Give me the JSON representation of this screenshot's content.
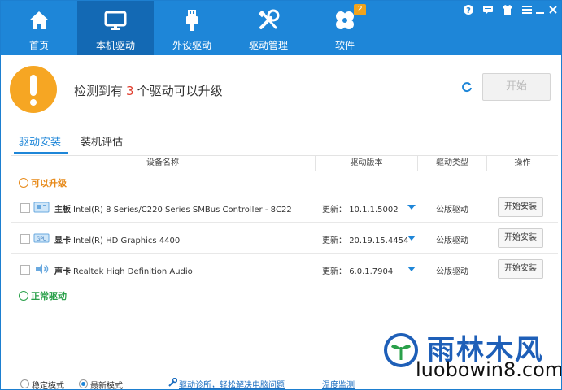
{
  "nav": {
    "items": [
      {
        "label": "首页",
        "icon": "home-icon"
      },
      {
        "label": "本机驱动",
        "icon": "monitor-icon"
      },
      {
        "label": "外设驱动",
        "icon": "usb-icon"
      },
      {
        "label": "驱动管理",
        "icon": "tools-icon"
      },
      {
        "label": "软件",
        "icon": "apps-icon"
      }
    ],
    "active_index": 1,
    "software_badge": "2",
    "window_controls": [
      "help-icon",
      "feedback-icon",
      "skin-icon",
      "menu-icon",
      "minimize-icon",
      "close-icon"
    ]
  },
  "status": {
    "prefix": "检测到有",
    "count": "3",
    "suffix": "个驱动可以升级",
    "start_label": "开始"
  },
  "subtabs": [
    {
      "label": "驱动安装",
      "active": true
    },
    {
      "label": "装机评估",
      "active": false
    }
  ],
  "table": {
    "headers": [
      "设备名称",
      "驱动版本",
      "驱动类型",
      "操作"
    ],
    "group_upgradable": "可以升级",
    "group_normal": "正常驱动",
    "rows": [
      {
        "category": "主板",
        "name": "Intel(R) 8 Series/C220 Series SMBus Controller - 8C22",
        "version_prefix": "更新：",
        "version": "10.1.1.5002",
        "type": "公版驱动",
        "action": "开始安装",
        "icon": "motherboard-icon"
      },
      {
        "category": "显卡",
        "name": "Intel(R) HD Graphics 4400",
        "version_prefix": "更新：",
        "version": "20.19.15.4454",
        "type": "公版驱动",
        "action": "开始安装",
        "icon": "gpu-icon"
      },
      {
        "category": "声卡",
        "name": "Realtek High Definition Audio",
        "version_prefix": "更新：",
        "version": "6.0.1.7904",
        "type": "公版驱动",
        "action": "开始安装",
        "icon": "speaker-icon"
      }
    ]
  },
  "footer": {
    "mode_stable": "稳定模式",
    "mode_latest": "最新模式",
    "selected_mode": "最新模式",
    "diagnose_link": "驱动诊所，轻松解决电脑问题",
    "temp_link": "温度监测"
  },
  "watermark": {
    "cn": "雨林木风",
    "en": "luobowin8.com"
  },
  "colors": {
    "primary": "#1e86d8",
    "nav_active": "#1369b4",
    "warning": "#f6a623",
    "count_red": "#e03b2b",
    "upgrade_orange": "#e78a1a",
    "normal_green": "#2aa04a"
  }
}
